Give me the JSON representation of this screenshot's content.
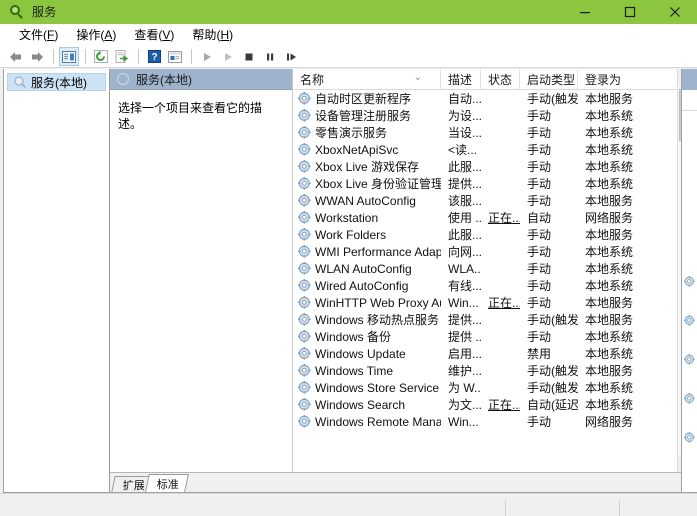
{
  "window": {
    "title": "服务",
    "title_icon": "services-magnifier-icon",
    "accent_color": "#8cc63e",
    "controls": {
      "minimize": "minimize-button",
      "maximize": "maximize-button",
      "close": "close-button"
    }
  },
  "menubar": [
    {
      "label": "文件",
      "accel": "F"
    },
    {
      "label": "操作",
      "accel": "A"
    },
    {
      "label": "查看",
      "accel": "V"
    },
    {
      "label": "帮助",
      "accel": "H"
    }
  ],
  "toolbar": [
    {
      "name": "back-button",
      "icon": "arrow-left-icon"
    },
    {
      "name": "forward-button",
      "icon": "arrow-right-icon"
    },
    {
      "sep": true
    },
    {
      "name": "show-hide-console-tree-button",
      "icon": "console-tree-icon",
      "active": true
    },
    {
      "sep": true
    },
    {
      "name": "refresh-button",
      "icon": "refresh-icon"
    },
    {
      "name": "export-list-button",
      "icon": "export-icon"
    },
    {
      "sep": true
    },
    {
      "name": "help-button",
      "icon": "help-icon"
    },
    {
      "name": "properties-button",
      "icon": "properties-icon"
    },
    {
      "sep": true
    },
    {
      "name": "start-service-button",
      "icon": "play-icon"
    },
    {
      "name": "resume-service-button",
      "icon": "play-gray-icon"
    },
    {
      "name": "stop-service-button",
      "icon": "stop-icon"
    },
    {
      "name": "pause-service-button",
      "icon": "pause-icon"
    },
    {
      "name": "restart-service-button",
      "icon": "restart-icon"
    }
  ],
  "tree": {
    "items": [
      {
        "label": "服务(本地)",
        "icon": "services-node-icon",
        "selected": true
      }
    ]
  },
  "pane_header": {
    "title": "服务(本地)",
    "icon": "services-circle-icon"
  },
  "description_panel": {
    "text": "选择一个项目来查看它的描述。"
  },
  "list": {
    "columns": [
      {
        "label": "名称",
        "sorted": true,
        "sort_glyph": "⌄"
      },
      {
        "label": "描述"
      },
      {
        "label": "状态"
      },
      {
        "label": "启动类型"
      },
      {
        "label": "登录为"
      }
    ],
    "rows": [
      {
        "name": "自动时区更新程序",
        "desc": "自动...",
        "status": "",
        "startup": "手动(触发...",
        "logon": "本地服务"
      },
      {
        "name": "设备管理注册服务",
        "desc": "为设...",
        "status": "",
        "startup": "手动",
        "logon": "本地系统"
      },
      {
        "name": "零售演示服务",
        "desc": "当设...",
        "status": "",
        "startup": "手动",
        "logon": "本地系统"
      },
      {
        "name": "XboxNetApiSvc",
        "desc": "<读...",
        "status": "",
        "startup": "手动",
        "logon": "本地系统"
      },
      {
        "name": "Xbox Live 游戏保存",
        "desc": "此服...",
        "status": "",
        "startup": "手动",
        "logon": "本地系统"
      },
      {
        "name": "Xbox Live 身份验证管理器",
        "desc": "提供...",
        "status": "",
        "startup": "手动",
        "logon": "本地系统"
      },
      {
        "name": "WWAN AutoConfig",
        "desc": "该服...",
        "status": "",
        "startup": "手动",
        "logon": "本地服务"
      },
      {
        "name": "Workstation",
        "desc": "使用 ...",
        "status": "正在...",
        "startup": "自动",
        "logon": "网络服务"
      },
      {
        "name": "Work Folders",
        "desc": "此服...",
        "status": "",
        "startup": "手动",
        "logon": "本地服务"
      },
      {
        "name": "WMI Performance Adapt...",
        "desc": "向网...",
        "status": "",
        "startup": "手动",
        "logon": "本地系统"
      },
      {
        "name": "WLAN AutoConfig",
        "desc": "WLA...",
        "status": "",
        "startup": "手动",
        "logon": "本地系统"
      },
      {
        "name": "Wired AutoConfig",
        "desc": "有线...",
        "status": "",
        "startup": "手动",
        "logon": "本地系统"
      },
      {
        "name": "WinHTTP Web Proxy Aut...",
        "desc": "Win...",
        "status": "正在...",
        "startup": "手动",
        "logon": "本地服务"
      },
      {
        "name": "Windows 移动热点服务",
        "desc": "提供...",
        "status": "",
        "startup": "手动(触发...",
        "logon": "本地服务"
      },
      {
        "name": "Windows 备份",
        "desc": "提供 ...",
        "status": "",
        "startup": "手动",
        "logon": "本地系统"
      },
      {
        "name": "Windows Update",
        "desc": "启用...",
        "status": "",
        "startup": "禁用",
        "logon": "本地系统"
      },
      {
        "name": "Windows Time",
        "desc": "维护...",
        "status": "",
        "startup": "手动(触发...",
        "logon": "本地服务"
      },
      {
        "name": "Windows Store Service (...",
        "desc": "为 W...",
        "status": "",
        "startup": "手动(触发...",
        "logon": "本地系统"
      },
      {
        "name": "Windows Search",
        "desc": "为文...",
        "status": "正在...",
        "startup": "自动(延迟...",
        "logon": "本地系统"
      },
      {
        "name": "Windows Remote Manag...",
        "desc": "Win...",
        "status": "",
        "startup": "手动",
        "logon": "网络服务"
      }
    ]
  },
  "scrollbar": {
    "up_arrow": "⌃",
    "down_arrow": "⌄"
  },
  "tabs": [
    {
      "label": "扩展",
      "selected": false
    },
    {
      "label": "标准",
      "selected": true
    }
  ]
}
